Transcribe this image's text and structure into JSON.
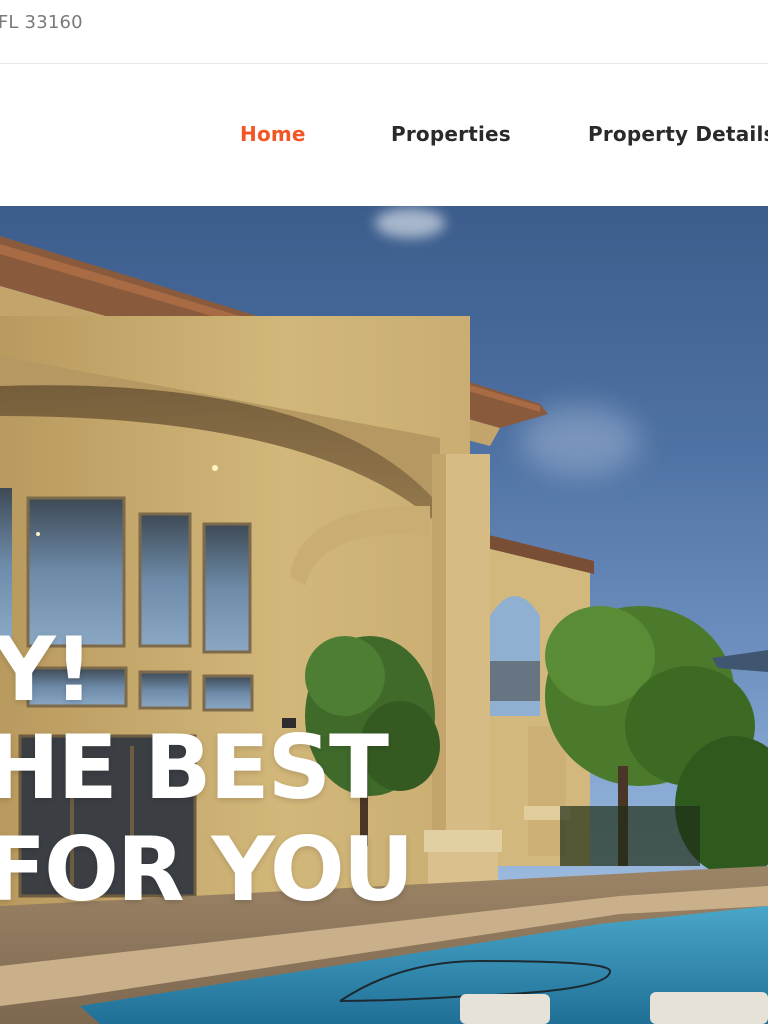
{
  "topbar": {
    "address": ", FL 33160"
  },
  "nav": {
    "items": [
      {
        "label": "Home",
        "active": true
      },
      {
        "label": "Properties",
        "active": false
      },
      {
        "label": "Property Details",
        "active": false
      }
    ]
  },
  "hero": {
    "line1": "Y!",
    "line2": "HE BEST",
    "line3": "FOR YOU"
  },
  "colors": {
    "accent": "#f35525",
    "text": "#2a2a2a",
    "muted": "#7a7a7a"
  }
}
